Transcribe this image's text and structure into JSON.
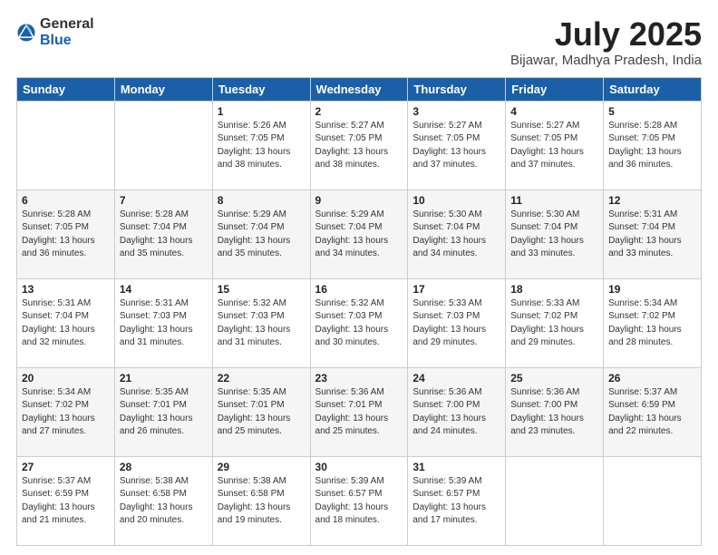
{
  "logo": {
    "general": "General",
    "blue": "Blue"
  },
  "title": "July 2025",
  "location": "Bijawar, Madhya Pradesh, India",
  "days_header": [
    "Sunday",
    "Monday",
    "Tuesday",
    "Wednesday",
    "Thursday",
    "Friday",
    "Saturday"
  ],
  "weeks": [
    [
      {
        "num": "",
        "info": ""
      },
      {
        "num": "",
        "info": ""
      },
      {
        "num": "1",
        "info": "Sunrise: 5:26 AM\nSunset: 7:05 PM\nDaylight: 13 hours\nand 38 minutes."
      },
      {
        "num": "2",
        "info": "Sunrise: 5:27 AM\nSunset: 7:05 PM\nDaylight: 13 hours\nand 38 minutes."
      },
      {
        "num": "3",
        "info": "Sunrise: 5:27 AM\nSunset: 7:05 PM\nDaylight: 13 hours\nand 37 minutes."
      },
      {
        "num": "4",
        "info": "Sunrise: 5:27 AM\nSunset: 7:05 PM\nDaylight: 13 hours\nand 37 minutes."
      },
      {
        "num": "5",
        "info": "Sunrise: 5:28 AM\nSunset: 7:05 PM\nDaylight: 13 hours\nand 36 minutes."
      }
    ],
    [
      {
        "num": "6",
        "info": "Sunrise: 5:28 AM\nSunset: 7:05 PM\nDaylight: 13 hours\nand 36 minutes."
      },
      {
        "num": "7",
        "info": "Sunrise: 5:28 AM\nSunset: 7:04 PM\nDaylight: 13 hours\nand 35 minutes."
      },
      {
        "num": "8",
        "info": "Sunrise: 5:29 AM\nSunset: 7:04 PM\nDaylight: 13 hours\nand 35 minutes."
      },
      {
        "num": "9",
        "info": "Sunrise: 5:29 AM\nSunset: 7:04 PM\nDaylight: 13 hours\nand 34 minutes."
      },
      {
        "num": "10",
        "info": "Sunrise: 5:30 AM\nSunset: 7:04 PM\nDaylight: 13 hours\nand 34 minutes."
      },
      {
        "num": "11",
        "info": "Sunrise: 5:30 AM\nSunset: 7:04 PM\nDaylight: 13 hours\nand 33 minutes."
      },
      {
        "num": "12",
        "info": "Sunrise: 5:31 AM\nSunset: 7:04 PM\nDaylight: 13 hours\nand 33 minutes."
      }
    ],
    [
      {
        "num": "13",
        "info": "Sunrise: 5:31 AM\nSunset: 7:04 PM\nDaylight: 13 hours\nand 32 minutes."
      },
      {
        "num": "14",
        "info": "Sunrise: 5:31 AM\nSunset: 7:03 PM\nDaylight: 13 hours\nand 31 minutes."
      },
      {
        "num": "15",
        "info": "Sunrise: 5:32 AM\nSunset: 7:03 PM\nDaylight: 13 hours\nand 31 minutes."
      },
      {
        "num": "16",
        "info": "Sunrise: 5:32 AM\nSunset: 7:03 PM\nDaylight: 13 hours\nand 30 minutes."
      },
      {
        "num": "17",
        "info": "Sunrise: 5:33 AM\nSunset: 7:03 PM\nDaylight: 13 hours\nand 29 minutes."
      },
      {
        "num": "18",
        "info": "Sunrise: 5:33 AM\nSunset: 7:02 PM\nDaylight: 13 hours\nand 29 minutes."
      },
      {
        "num": "19",
        "info": "Sunrise: 5:34 AM\nSunset: 7:02 PM\nDaylight: 13 hours\nand 28 minutes."
      }
    ],
    [
      {
        "num": "20",
        "info": "Sunrise: 5:34 AM\nSunset: 7:02 PM\nDaylight: 13 hours\nand 27 minutes."
      },
      {
        "num": "21",
        "info": "Sunrise: 5:35 AM\nSunset: 7:01 PM\nDaylight: 13 hours\nand 26 minutes."
      },
      {
        "num": "22",
        "info": "Sunrise: 5:35 AM\nSunset: 7:01 PM\nDaylight: 13 hours\nand 25 minutes."
      },
      {
        "num": "23",
        "info": "Sunrise: 5:36 AM\nSunset: 7:01 PM\nDaylight: 13 hours\nand 25 minutes."
      },
      {
        "num": "24",
        "info": "Sunrise: 5:36 AM\nSunset: 7:00 PM\nDaylight: 13 hours\nand 24 minutes."
      },
      {
        "num": "25",
        "info": "Sunrise: 5:36 AM\nSunset: 7:00 PM\nDaylight: 13 hours\nand 23 minutes."
      },
      {
        "num": "26",
        "info": "Sunrise: 5:37 AM\nSunset: 6:59 PM\nDaylight: 13 hours\nand 22 minutes."
      }
    ],
    [
      {
        "num": "27",
        "info": "Sunrise: 5:37 AM\nSunset: 6:59 PM\nDaylight: 13 hours\nand 21 minutes."
      },
      {
        "num": "28",
        "info": "Sunrise: 5:38 AM\nSunset: 6:58 PM\nDaylight: 13 hours\nand 20 minutes."
      },
      {
        "num": "29",
        "info": "Sunrise: 5:38 AM\nSunset: 6:58 PM\nDaylight: 13 hours\nand 19 minutes."
      },
      {
        "num": "30",
        "info": "Sunrise: 5:39 AM\nSunset: 6:57 PM\nDaylight: 13 hours\nand 18 minutes."
      },
      {
        "num": "31",
        "info": "Sunrise: 5:39 AM\nSunset: 6:57 PM\nDaylight: 13 hours\nand 17 minutes."
      },
      {
        "num": "",
        "info": ""
      },
      {
        "num": "",
        "info": ""
      }
    ]
  ]
}
